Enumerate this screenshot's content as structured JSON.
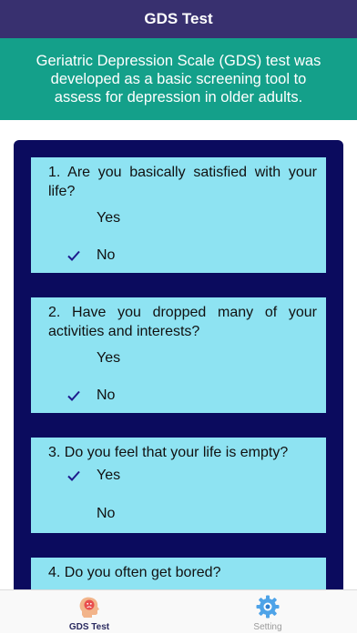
{
  "navbar": {
    "title": "GDS Test"
  },
  "intro": {
    "text": "Geriatric Depression Scale (GDS) test was developed as a basic screening tool to assess for depression in older adults."
  },
  "questions": [
    {
      "text": "1. Are you basically satisfied with your life?",
      "options": [
        {
          "label": "Yes",
          "selected": false
        },
        {
          "label": "No",
          "selected": true
        }
      ]
    },
    {
      "text": "2. Have you dropped many of your activities and interests?",
      "options": [
        {
          "label": "Yes",
          "selected": false
        },
        {
          "label": "No",
          "selected": true
        }
      ]
    },
    {
      "text": "3. Do you feel that your life is empty?",
      "options": [
        {
          "label": "Yes",
          "selected": true
        },
        {
          "label": "No",
          "selected": false
        }
      ]
    },
    {
      "text": "4. Do you often get bored?"
    }
  ],
  "tabbar": {
    "tabs": [
      {
        "label": "GDS Test",
        "icon": "head-icon",
        "active": true
      },
      {
        "label": "Setting",
        "icon": "gear-icon",
        "active": false
      }
    ]
  },
  "colors": {
    "navbar": "#38306f",
    "intro": "#14a08a",
    "panel": "#0b0b5e",
    "card": "#8ee3f2",
    "check": "#1e1a8c"
  }
}
